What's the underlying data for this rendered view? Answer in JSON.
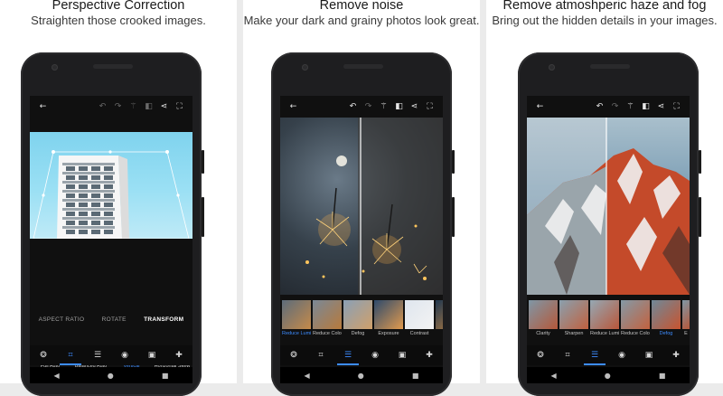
{
  "panels": [
    {
      "title": "Perspective Correction",
      "subtitle": "Straighten those crooked images.",
      "tabs": [
        "ASPECT RATIO",
        "ROTATE",
        "TRANSFORM"
      ],
      "active_tab": "TRANSFORM",
      "tools": [
        "Full Auto",
        "Balanced Auto",
        "Vertical",
        "Horizontal Skew"
      ],
      "active_tool": "Vertical"
    },
    {
      "title": "Remove noise",
      "subtitle": "Make your dark and grainy photos look great.",
      "filters": [
        "Reduce Lumin…",
        "Reduce Colo…",
        "Defog",
        "Exposure",
        "Contrast"
      ],
      "active_filter": "Reduce Lumin…"
    },
    {
      "title": "Remove atmoshperic haze and fog",
      "subtitle": "Bring out the hidden details in your images.",
      "filters": [
        "Clarity",
        "Sharpen",
        "Reduce Lumi…",
        "Reduce Colo…",
        "Defog",
        "E"
      ],
      "active_filter": "Defog"
    }
  ],
  "icons": {
    "top": [
      "back-arrow-icon",
      "undo-icon",
      "redo-icon",
      "auto-fix-wand-icon",
      "compare-icon",
      "share-icon",
      "fullscreen-icon"
    ],
    "bottom": [
      "looks-icon",
      "crop-icon",
      "adjust-sliders-icon",
      "red-eye-icon",
      "stickers-icon",
      "healing-icon"
    ],
    "system": [
      "back-triangle-icon",
      "home-circle-icon",
      "recents-square-icon"
    ]
  },
  "colors": {
    "accent": "#3d8cff",
    "app_background": "#101010"
  }
}
